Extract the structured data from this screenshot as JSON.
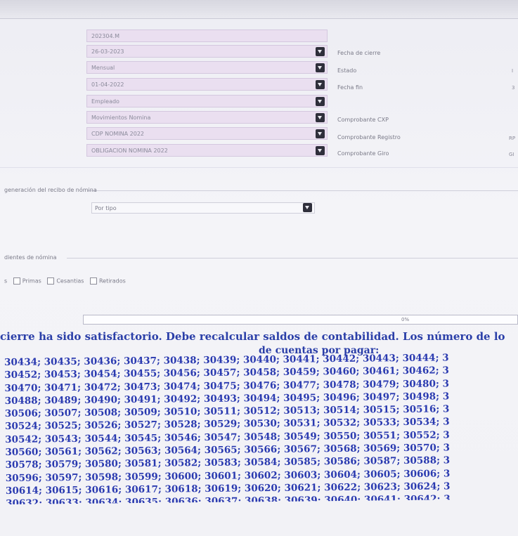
{
  "form": {
    "periodo": "202304.M",
    "fecha_corte": "26-03-2023",
    "mensual": "Mensual",
    "fecha_inicio": "01-04-2022",
    "empleado": "Empleado",
    "movimientos": "Movimientos Nomina",
    "cdp": "CDP NOMINA 2022",
    "obligacion": "OBLIGACION NOMINA 2022"
  },
  "right_labels": {
    "fecha_cierre": "Fecha de cierre",
    "estado": "Estado",
    "fecha_fin": "Fecha fin",
    "comprobante_cxp": "Comprobante CXP",
    "comprobante_registro": "Comprobante Registro",
    "comprobante_giro": "Comprobante Giro"
  },
  "right_values": {
    "estado_val": "I",
    "fecha_fin_val": "3",
    "registro_val": "RP",
    "giro_val": "GI"
  },
  "recibo": {
    "legend": "generación del recibo de nómina",
    "selected": "Por tipo"
  },
  "pendientes": {
    "legend": "dientes de nómina",
    "prefix": "s",
    "primas": "Primas",
    "cesantias": "Cesantias",
    "retirados": "Retirados"
  },
  "progress": {
    "percent_label": "0%",
    "value": 0
  },
  "message": {
    "title": "cierre ha sido satisfactorio. Debe recalcular saldos de contabilidad. Los número de lo",
    "subtitle": "de cuentas por pagar:",
    "rows": [
      "30434; 30435; 30436; 30437; 30438; 30439; 30440; 30441; 30442; 30443; 30444; 3",
      "30452; 30453; 30454; 30455; 30456; 30457; 30458; 30459; 30460; 30461; 30462; 3",
      "30470; 30471; 30472; 30473; 30474; 30475; 30476; 30477; 30478; 30479; 30480; 3",
      "30488; 30489; 30490; 30491; 30492; 30493; 30494; 30495; 30496; 30497; 30498; 3",
      "30506; 30507; 30508; 30509; 30510; 30511; 30512; 30513; 30514; 30515; 30516; 3",
      "30524; 30525; 30526; 30527; 30528; 30529; 30530; 30531; 30532; 30533; 30534; 3",
      "30542; 30543; 30544; 30545; 30546; 30547; 30548; 30549; 30550; 30551; 30552; 3",
      "30560; 30561; 30562; 30563; 30564; 30565; 30566; 30567; 30568; 30569; 30570; 3",
      "30578; 30579; 30580; 30581; 30582; 30583; 30584; 30585; 30586; 30587; 30588; 3",
      "30596; 30597; 30598; 30599; 30600; 30601; 30602; 30603; 30604; 30605; 30606; 3",
      "30614; 30615; 30616; 30617; 30618; 30619; 30620; 30621; 30622; 30623; 30624; 3",
      "30632; 30633; 30634; 30635; 30636; 30637; 30638; 30639; 30640; 30641; 30642; 3"
    ]
  }
}
